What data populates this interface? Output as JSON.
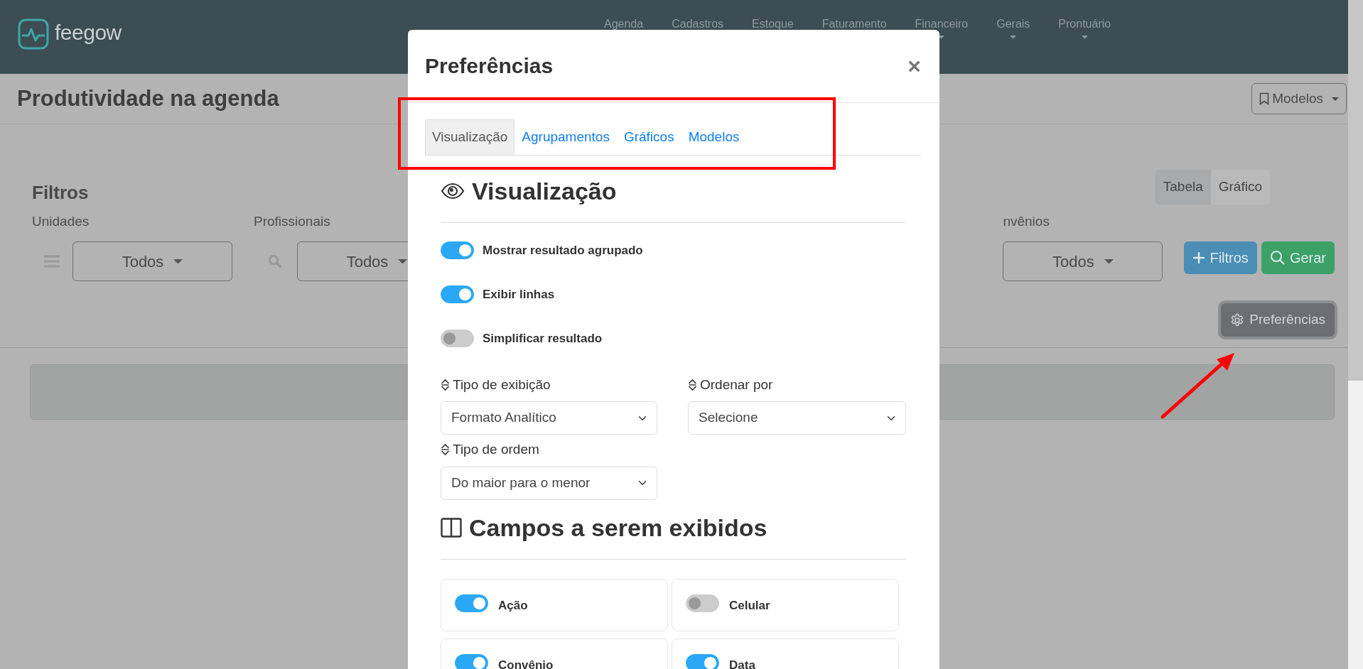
{
  "app": {
    "logo_text": "feegow"
  },
  "nav_menu": [
    {
      "label": "Agenda",
      "caret": false
    },
    {
      "label": "Cadastros",
      "caret": false
    },
    {
      "label": "Estoque",
      "caret": false
    },
    {
      "label": "Faturamento",
      "caret": false
    },
    {
      "label": "Financeiro",
      "caret": true
    },
    {
      "label": "Gerais",
      "caret": true
    },
    {
      "label": "Prontuário",
      "caret": true
    }
  ],
  "page": {
    "title": "Produtividade na agenda",
    "models_button": "Modelos"
  },
  "view_toggle": [
    {
      "label": "Tabela",
      "selected": true
    },
    {
      "label": "Gráfico",
      "selected": false
    }
  ],
  "filters": {
    "title": "Filtros",
    "groups": [
      {
        "label": "Unidades",
        "kind": "list",
        "value": "Todos"
      },
      {
        "label": "Profissionais",
        "kind": "search",
        "value": "Todos"
      },
      {
        "label": "nvênios",
        "kind": "none",
        "value": "Todos"
      }
    ]
  },
  "actions": [
    {
      "label": "Filtros",
      "kind": "add"
    },
    {
      "label": "Gerar",
      "kind": "generate"
    }
  ],
  "preferences_button": "Preferências",
  "modal": {
    "title": "Preferências",
    "close": "×",
    "tabs": [
      {
        "label": "Visualização",
        "selected": true
      },
      {
        "label": "Agrupamentos",
        "selected": false
      },
      {
        "label": "Gráficos",
        "selected": false
      },
      {
        "label": "Modelos",
        "selected": false
      }
    ],
    "section_title": "Visualização",
    "options": [
      {
        "label": "Mostrar resultado agrupado",
        "on": true
      },
      {
        "label": "Exibir linhas",
        "on": true
      },
      {
        "label": "Simplificar resultado",
        "on": false
      }
    ],
    "selects": [
      {
        "label": "Tipo de exibição",
        "value": "Formato Analítico"
      },
      {
        "label": "Ordenar por",
        "value": "Selecione"
      },
      {
        "label": "Tipo de ordem",
        "value": "Do maior para o menor"
      }
    ],
    "fields_title": "Campos a serem exibidos",
    "fields": [
      {
        "label": "Ação",
        "on": true
      },
      {
        "label": "Celular",
        "on": false
      },
      {
        "label": "Convênio",
        "on": true
      },
      {
        "label": "Data",
        "on": true
      }
    ]
  }
}
